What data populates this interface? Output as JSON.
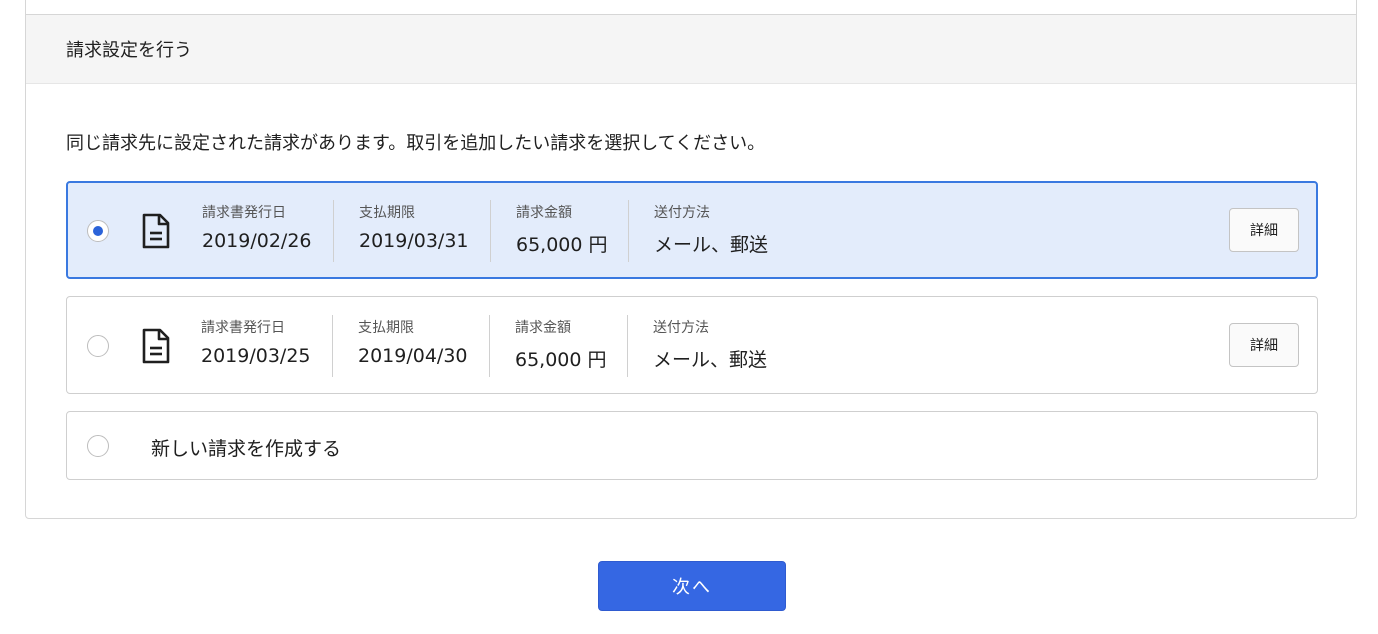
{
  "card": {
    "header_title": "請求設定を行う",
    "instruction": "同じ請求先に設定された請求があります。取引を追加したい請求を選択してください。"
  },
  "field_labels": {
    "issue_date": "請求書発行日",
    "due_date": "支払期限",
    "amount": "請求金額",
    "delivery": "送付方法"
  },
  "invoices": [
    {
      "selected": true,
      "issue_date": "2019/02/26",
      "due_date": "2019/03/31",
      "amount": "65,000 円",
      "delivery": "メール、郵送",
      "detail_label": "詳細"
    },
    {
      "selected": false,
      "issue_date": "2019/03/25",
      "due_date": "2019/04/30",
      "amount": "65,000 円",
      "delivery": "メール、郵送",
      "detail_label": "詳細"
    }
  ],
  "new_invoice": {
    "label": "新しい請求を作成する"
  },
  "next_button": {
    "label": "次へ"
  },
  "icons": {
    "invoice": "document-icon",
    "radio": "radio-button-icon"
  },
  "colors": {
    "primary": "#3567e3",
    "selected_bg": "#e3ecfb",
    "selected_border": "#3a79e0"
  }
}
